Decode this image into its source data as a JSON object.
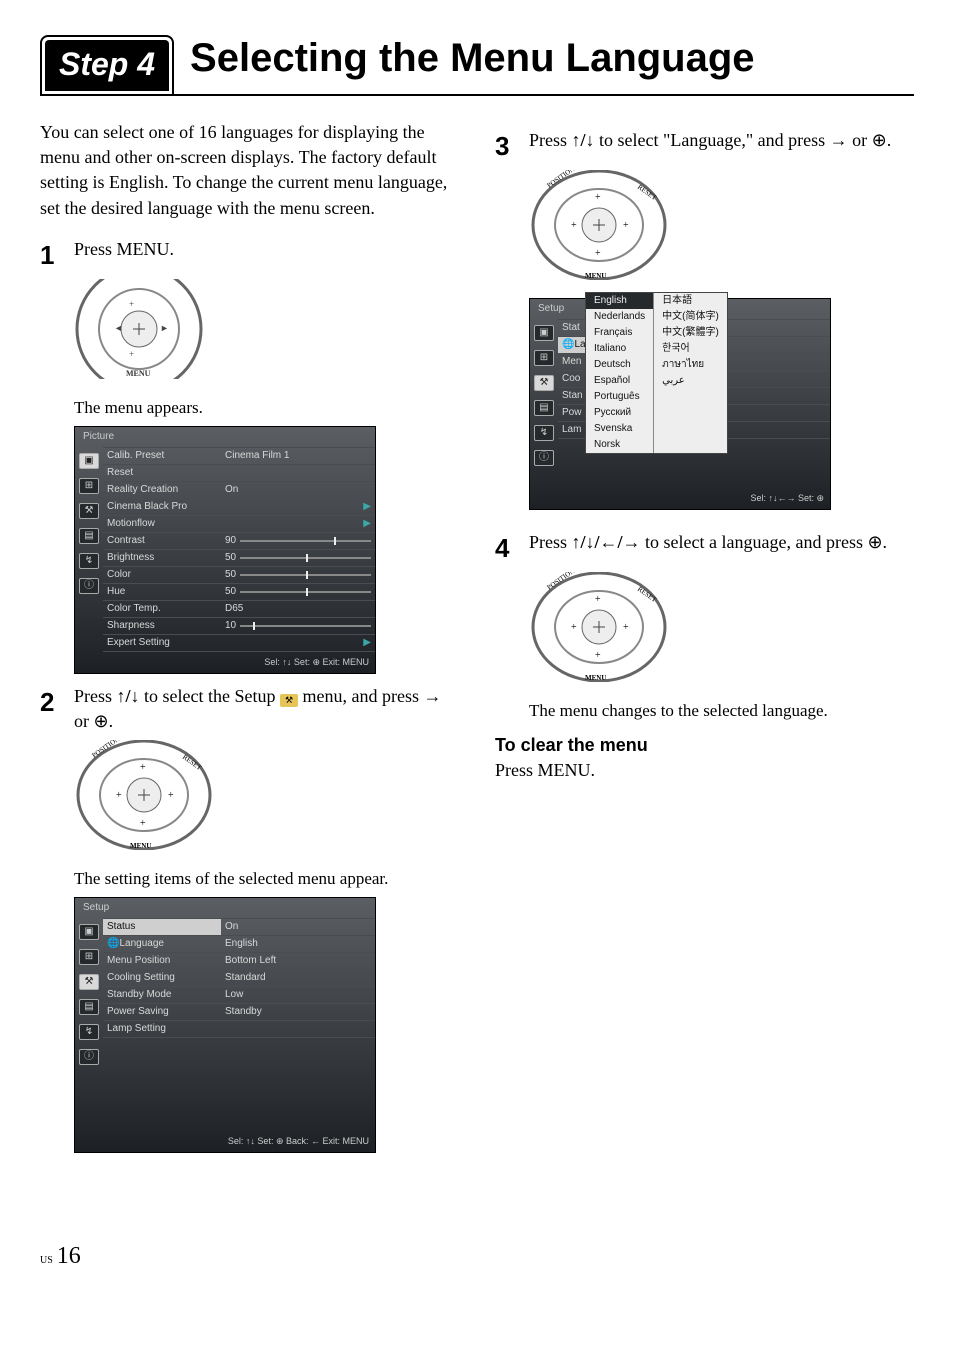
{
  "step_label": "Step 4",
  "page_title": "Selecting the Menu Language",
  "intro": "You can select one of 16 languages for displaying the menu and other on-screen displays. The factory default setting is English. To change the current menu language, set the desired language with the menu screen.",
  "col_left": {
    "step1_body": "Press MENU.",
    "after_step1": "The menu appears.",
    "picture_menu": {
      "title": "Picture",
      "rows": [
        {
          "l": "Calib. Preset",
          "r": "Cinema Film 1"
        },
        {
          "l": "Reset",
          "r": ""
        },
        {
          "l": "Reality Creation",
          "r": "On"
        },
        {
          "l": "Cinema Black Pro",
          "r": "",
          "tri": true
        },
        {
          "l": "Motionflow",
          "r": "",
          "tri": true
        },
        {
          "l": "Contrast",
          "r": "90",
          "slider": 72
        },
        {
          "l": "Brightness",
          "r": "50",
          "slider": 50
        },
        {
          "l": "Color",
          "r": "50",
          "slider": 50
        },
        {
          "l": "Hue",
          "r": "50",
          "slider": 50
        },
        {
          "l": "Color Temp.",
          "r": "D65"
        },
        {
          "l": "Sharpness",
          "r": "10",
          "slider": 10
        },
        {
          "l": "Expert Setting",
          "r": "",
          "tri": true
        }
      ],
      "footer": "Sel: ↑↓  Set: ⊕  Exit: MENU"
    },
    "step2_pre": "Press ",
    "step2_mid": " to select the Setup ",
    "step2_post": " menu, and press → or ⊕.",
    "after_step2": "The setting items of the selected menu appear.",
    "setup_menu": {
      "title": "Setup",
      "rows": [
        {
          "l": "Status",
          "r": "On",
          "sel": true
        },
        {
          "l": "🌐Language",
          "r": "English"
        },
        {
          "l": "Menu Position",
          "r": "Bottom Left"
        },
        {
          "l": "Cooling Setting",
          "r": "Standard"
        },
        {
          "l": "Standby Mode",
          "r": "Low"
        },
        {
          "l": "Power Saving",
          "r": "Standby"
        },
        {
          "l": "Lamp Setting",
          "r": ""
        }
      ],
      "footer": "Sel: ↑↓  Set: ⊕  Back: ←  Exit: MENU"
    }
  },
  "col_right": {
    "step3_pre": "Press ",
    "step3_mid": " to select \"Language,\" and press → or ⊕.",
    "lang_menu": {
      "title": "Setup",
      "peek": [
        "Stat",
        "🌐La",
        "Men",
        "Coo",
        "Stan",
        "Pow",
        "Lam"
      ],
      "col1": [
        "English",
        "Nederlands",
        "Français",
        "Italiano",
        "Deutsch",
        "Español",
        "Português",
        "Русский",
        "Svenska",
        "Norsk"
      ],
      "col2": [
        "日本語",
        "中文(简体字)",
        "中文(繁體字)",
        "한국어",
        "ภาษาไทย",
        "عربي"
      ],
      "footer": "Sel: ↑↓←→  Set: ⊕"
    },
    "step4_pre": "Press ",
    "step4_mid": " to select a language, and press ⊕.",
    "after_step4": "The menu changes to the selected language.",
    "clear_head": "To clear the menu",
    "clear_body": "Press MENU."
  },
  "footer": {
    "region": "US",
    "page": "16"
  }
}
